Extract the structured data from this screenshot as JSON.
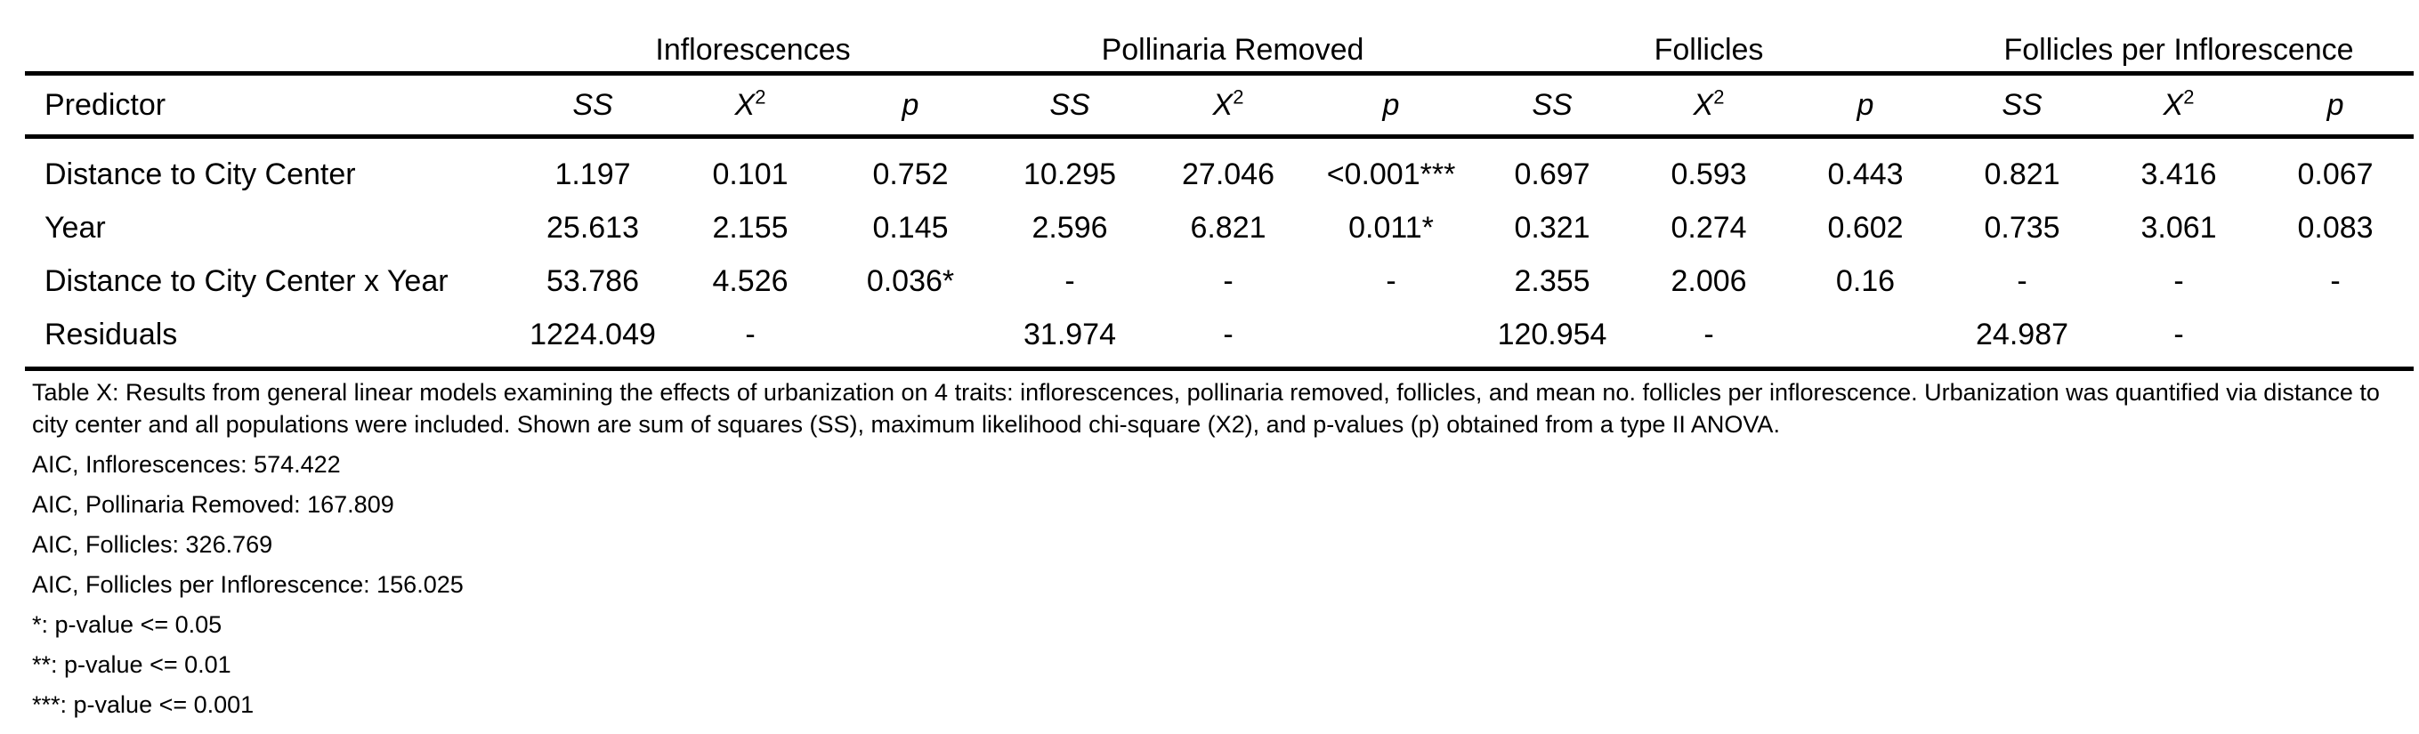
{
  "table": {
    "group_headers": [
      "Inflorescences",
      "Pollinaria Removed",
      "Follicles",
      "Follicles per Inflorescence"
    ],
    "predictor_header": "Predictor",
    "sub_headers": {
      "ss": "SS",
      "chi_base": "X",
      "chi_sup": "2",
      "p": "p"
    },
    "rows": [
      {
        "predictor": "Distance to City Center",
        "cells": [
          "1.197",
          "0.101",
          "0.752",
          "10.295",
          "27.046",
          "<0.001***",
          "0.697",
          "0.593",
          "0.443",
          "0.821",
          "3.416",
          "0.067"
        ]
      },
      {
        "predictor": "Year",
        "cells": [
          "25.613",
          "2.155",
          "0.145",
          "2.596",
          "6.821",
          "0.011*",
          "0.321",
          "0.274",
          "0.602",
          "0.735",
          "3.061",
          "0.083"
        ]
      },
      {
        "predictor": "Distance to City Center x Year",
        "cells": [
          "53.786",
          "4.526",
          "0.036*",
          "-",
          "-",
          "-",
          "2.355",
          "2.006",
          "0.16",
          "-",
          "-",
          "-"
        ]
      },
      {
        "predictor": "Residuals",
        "cells": [
          "1224.049",
          "-",
          "",
          "31.974",
          "-",
          "",
          "120.954",
          "-",
          "",
          "24.987",
          "-",
          ""
        ]
      }
    ]
  },
  "caption": "Table X: Results from general linear models examining the effects of urbanization on 4 traits: inflorescences, pollinaria removed, follicles, and mean no. follicles per inflorescence. Urbanization was quantified via distance to city center and all populations were included. Shown are sum of squares (SS), maximum likelihood chi-square (X2), and p-values (p) obtained from a type II ANOVA.",
  "notes": [
    "AIC, Inflorescences: 574.422",
    "AIC, Pollinaria Removed: 167.809",
    "AIC, Follicles: 326.769",
    "AIC, Follicles per Inflorescence: 156.025",
    "*: p-value <= 0.05",
    "**: p-value <= 0.01",
    "***: p-value <= 0.001"
  ]
}
